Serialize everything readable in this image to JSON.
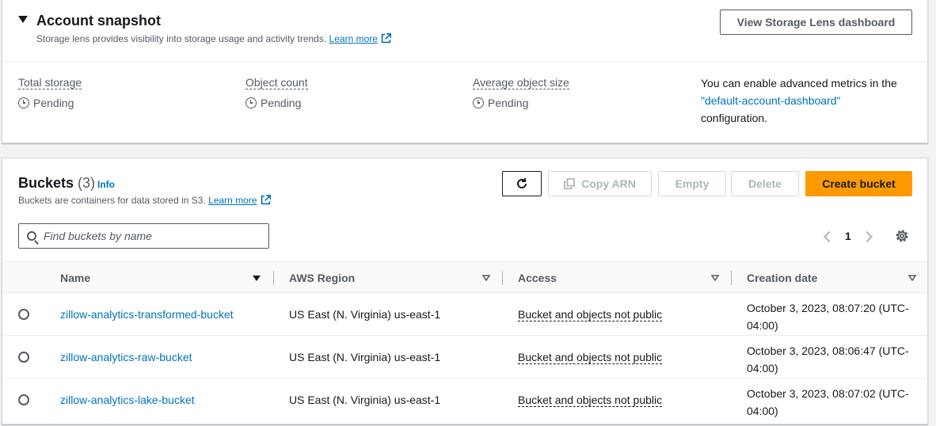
{
  "snapshot": {
    "title": "Account snapshot",
    "description": "Storage lens provides visibility into storage usage and activity trends.",
    "learn_more": "Learn more",
    "dashboard_button": "View Storage Lens dashboard",
    "metrics": [
      {
        "label": "Total storage",
        "value": "Pending"
      },
      {
        "label": "Object count",
        "value": "Pending"
      },
      {
        "label": "Average object size",
        "value": "Pending"
      }
    ],
    "advanced": {
      "prefix": "You can enable advanced metrics in the",
      "link": "\"default-account-dashboard\"",
      "suffix": "configuration."
    }
  },
  "buckets": {
    "title": "Buckets",
    "count": "(3)",
    "info": "Info",
    "description": "Buckets are containers for data stored in S3.",
    "learn_more": "Learn more",
    "actions": {
      "copy_arn": "Copy ARN",
      "empty": "Empty",
      "delete": "Delete",
      "create": "Create bucket"
    },
    "search_placeholder": "Find buckets by name",
    "page": "1",
    "columns": [
      "Name",
      "AWS Region",
      "Access",
      "Creation date"
    ],
    "rows": [
      {
        "name": "zillow-analytics-transformed-bucket",
        "region": "US East (N. Virginia) us-east-1",
        "access": "Bucket and objects not public",
        "date_line1": "October 3, 2023, 08:07:20 (UTC-",
        "date_line2": "04:00)"
      },
      {
        "name": "zillow-analytics-raw-bucket",
        "region": "US East (N. Virginia) us-east-1",
        "access": "Bucket and objects not public",
        "date_line1": "October 3, 2023, 08:06:47 (UTC-",
        "date_line2": "04:00)"
      },
      {
        "name": "zillow-analytics-lake-bucket",
        "region": "US East (N. Virginia) us-east-1",
        "access": "Bucket and objects not public",
        "date_line1": "October 3, 2023, 08:07:02 (UTC-",
        "date_line2": "04:00)"
      }
    ]
  },
  "colors": {
    "link": "#0073bb",
    "primary_button": "#ff9900",
    "text": "#16191f",
    "muted": "#545b64"
  }
}
